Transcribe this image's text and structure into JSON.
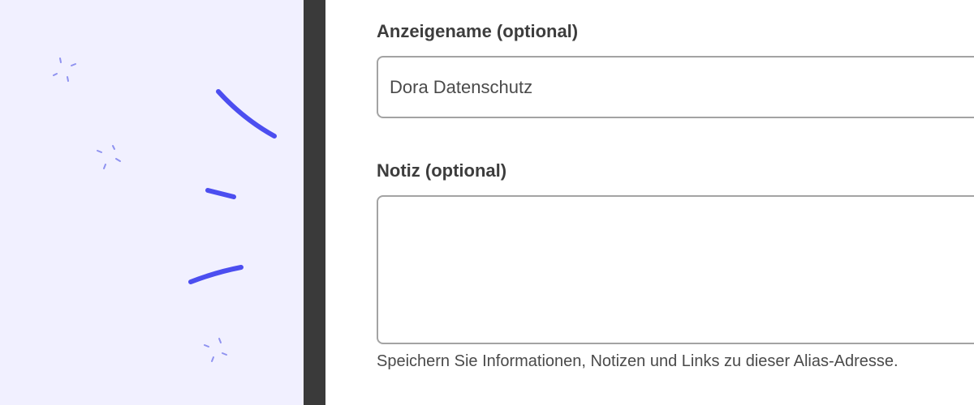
{
  "form": {
    "display_name": {
      "label": "Anzeigename (optional)",
      "value": "Dora Datenschutz"
    },
    "note": {
      "label": "Notiz (optional)",
      "value": "",
      "helper": "Speichern Sie Informationen, Notizen und Links zu dieser Alias-Adresse."
    }
  },
  "colors": {
    "illustration_background": "#f1f0ff",
    "accent_stroke": "#4c4ef0",
    "sparkle": "#8f92f0",
    "divider": "#3a3a3a",
    "label_text": "#3d3d3d",
    "input_border": "#a3a3a3"
  },
  "icons": {
    "decoration": [
      "sparkle-icon",
      "confetti-stroke-icon"
    ]
  }
}
